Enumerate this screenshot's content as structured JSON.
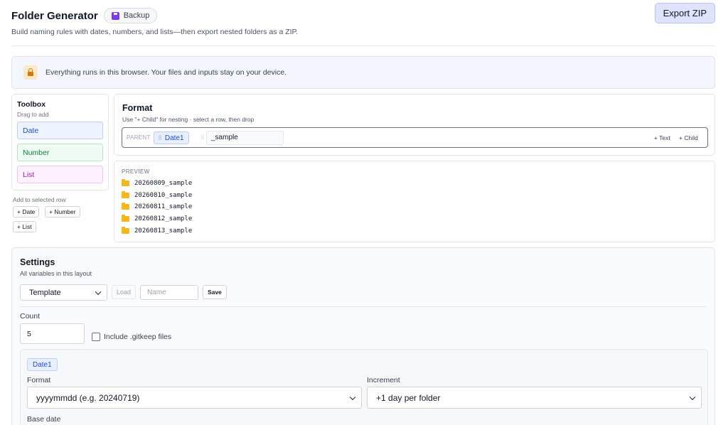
{
  "header": {
    "title": "Folder Generator",
    "backup_label": "Backup",
    "export_label": "Export ZIP",
    "subtitle": "Build naming rules with dates, numbers, and lists—then export nested folders as a ZIP."
  },
  "notice": {
    "text": "Everything runs in this browser. Your files and inputs stay on your device."
  },
  "toolbox": {
    "title": "Toolbox",
    "subtitle": "Drag to add",
    "chips": [
      "Date",
      "Number",
      "List"
    ],
    "add_label": "Add to selected row",
    "add_buttons": [
      "+ Date",
      "+ Number",
      "+ List"
    ]
  },
  "format": {
    "title": "Format",
    "subtitle": "Use \"+ Child\" for nesting · select a row, then drop",
    "row": {
      "parent_label": "PARENT",
      "token": "Date1",
      "text_value": "_sample",
      "add_text": "+ Text",
      "add_child": "+ Child"
    }
  },
  "preview": {
    "label": "PREVIEW",
    "items": [
      "20260809_sample",
      "20260810_sample",
      "20260811_sample",
      "20260812_sample",
      "20260813_sample"
    ]
  },
  "settings": {
    "title": "Settings",
    "subtitle": "All variables in this layout",
    "template_select": "Template",
    "load_label": "Load",
    "name_placeholder": "Name",
    "save_label": "Save",
    "count_label": "Count",
    "count_value": "5",
    "gitkeep_label": "Include .gitkeep files",
    "date_var": {
      "name": "Date1",
      "format_label": "Format",
      "format_value": "yyyymmdd (e.g. 20240719)",
      "increment_label": "Increment",
      "increment_value": "+1 day per folder",
      "base_date_label": "Base date"
    }
  },
  "colors": {
    "accent": "#dfe4fd",
    "date": "#1d4ed8",
    "number": "#15803d",
    "list": "#a21caf",
    "folder": "#f5b81c"
  }
}
